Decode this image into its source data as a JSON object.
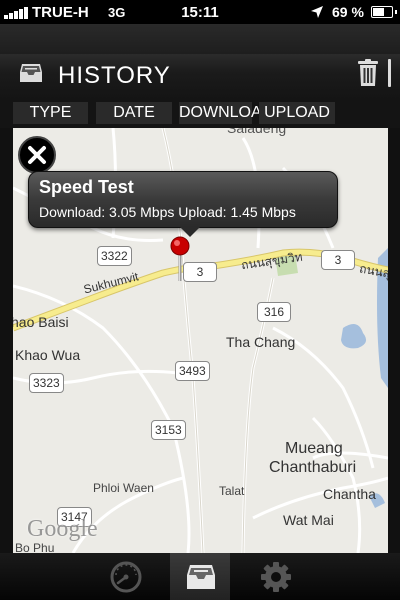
{
  "status_bar": {
    "carrier": "TRUE-H",
    "network": "3G",
    "time": "15:11",
    "battery_percent": "69 %",
    "battery_level": 0.69
  },
  "header": {
    "title": "HISTORY"
  },
  "columns": [
    {
      "label": "TYPE"
    },
    {
      "label": "DATE"
    },
    {
      "label": "DOWNLOAD"
    },
    {
      "label": "UPLOAD"
    }
  ],
  "callout": {
    "title": "Speed Test",
    "details": "Download:  3.05 Mbps Upload: 1.45 Mbps"
  },
  "map": {
    "places": [
      "Sukhumvit",
      "ถนนสุขุมวิท",
      "ถนนสุขุมวิ",
      "hao Baisi",
      "Khao Wua",
      "Tha Chang",
      "Mueang",
      "Chanthaburi",
      "Chantha",
      "Phloi Waen",
      "Talat",
      "Wat Mai",
      "Bo Phu",
      "Saladeng"
    ],
    "route_shields": [
      "3322",
      "3",
      "3",
      "316",
      "3323",
      "3493",
      "3153",
      "3147"
    ],
    "attribution": "Google"
  },
  "toolbar": {
    "items": [
      {
        "icon": "speedometer-icon"
      },
      {
        "icon": "history-tray-icon",
        "active": true
      },
      {
        "icon": "gear-icon"
      }
    ]
  }
}
